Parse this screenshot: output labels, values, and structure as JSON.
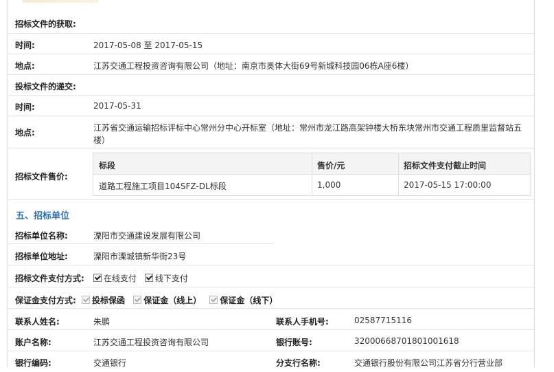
{
  "rows": {
    "acquire_title": "招标文件的获取:",
    "acquire_time_label": "时间:",
    "acquire_time_value": "2017-05-08 至 2017-05-15",
    "acquire_place_label": "地点:",
    "acquire_place_value": "江苏交通工程投资咨询有限公司（地址：南京市奥体大街69号新城科技园06栋A座6楼）",
    "submit_title": "投标文件的递交:",
    "submit_time_label": "时间:",
    "submit_time_value": "2017-05-31",
    "submit_place_label": "地点:",
    "submit_place_value_line1": "江苏省交通运输招标评标中心常州分中心开标室（地址：常州市龙江路高架钟楼大桥东块常州市交通工程质里监督站五",
    "submit_place_value_line2": "楼）",
    "price_label": "招标文件售价:"
  },
  "price_table": {
    "headers": [
      "标段",
      "售价/元",
      "招标文件支付截止时间"
    ],
    "rows": [
      [
        "道路工程施工项目104SFZ-DL标段",
        "1,000",
        "2017-05-15 17:00:00"
      ]
    ]
  },
  "section5": {
    "title": "五、招标单位",
    "org_name_label": "招标单位名称:",
    "org_name_value": "溧阳市交通建设发展有限公司",
    "org_addr_label": "招标单位地址:",
    "org_addr_value": "溧阳市溧城镇新华街23号",
    "pay_method_label": "招标文件支付方式:",
    "pay_online": "在线支付",
    "pay_offline": "线下支付",
    "deposit_label": "保证金支付方式:",
    "deposit_guarantee": "投标保函",
    "deposit_online": "保证金（线上）",
    "deposit_offline": "保证金（线下）",
    "contact_name_label": "联系人姓名:",
    "contact_name_value": "朱鹏",
    "contact_phone_label": "联系人手机号:",
    "contact_phone_value": "02587715116",
    "account_name_label": "账户名称:",
    "account_name_value": "江苏交通工程投资咨询有限公司",
    "bank_account_label": "银行账号:",
    "bank_account_value": "32000668701801001618",
    "bank_code_label": "银行编码:",
    "bank_code_value": "交通银行",
    "branch_label": "分支行名称:",
    "branch_value": "交通银行股份有限公司江苏省分行营业部"
  },
  "colors": {
    "section_title": "#2d6fb3",
    "border": "#e4e4e4",
    "header_bg": "#f4f4f4"
  }
}
